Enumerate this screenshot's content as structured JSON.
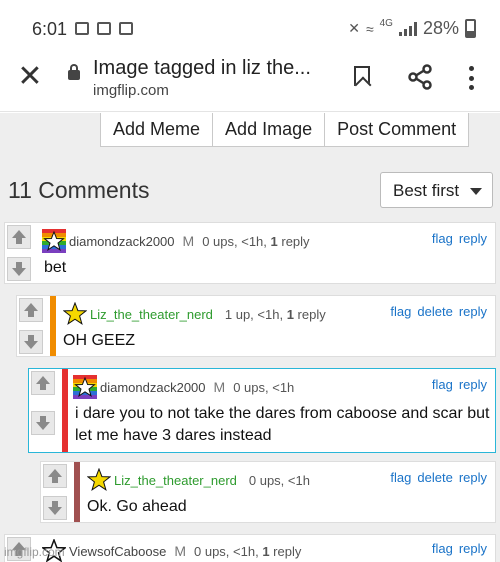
{
  "status": {
    "time": "6:01",
    "network": "4G",
    "battery": "28%"
  },
  "browser": {
    "title": "Image tagged in liz the...",
    "url": "imgflip.com"
  },
  "actions": {
    "add_meme": "Add Meme",
    "add_image": "Add Image",
    "post_comment": "Post Comment"
  },
  "comments_header": {
    "count_label": "11 Comments",
    "sort_selected": "Best first"
  },
  "comments": [
    {
      "user": "diamondzack2000",
      "badge": "M",
      "meta_pre": "0 ups, <1h, ",
      "meta_bold": "1",
      "meta_post": " reply",
      "links": [
        "flag",
        "reply"
      ],
      "text": "bet",
      "accent": ""
    },
    {
      "user": "Liz_the_theater_nerd",
      "badge": "",
      "meta_pre": "1 up, <1h, ",
      "meta_bold": "1",
      "meta_post": " reply",
      "links": [
        "flag",
        "delete",
        "reply"
      ],
      "text": "OH GEEZ",
      "accent": "#f08c00"
    },
    {
      "user": "diamondzack2000",
      "badge": "M",
      "meta_pre": "0 ups, <1h",
      "meta_bold": "",
      "meta_post": "",
      "links": [
        "flag",
        "reply"
      ],
      "text": "i dare you to not take the dares from caboose and scar but let me have 3 dares instead",
      "accent": "#e53030"
    },
    {
      "user": "Liz_the_theater_nerd",
      "badge": "",
      "meta_pre": "0 ups, <1h",
      "meta_bold": "",
      "meta_post": "",
      "links": [
        "flag",
        "delete",
        "reply"
      ],
      "text": "Ok. Go ahead",
      "accent": "#a05050"
    },
    {
      "user": "ViewsofCaboose",
      "badge": "M",
      "meta_pre": "0 ups, <1h, ",
      "meta_bold": "1",
      "meta_post": " reply",
      "links": [
        "flag",
        "reply"
      ],
      "text": "",
      "accent": ""
    }
  ],
  "watermark": "imgflip.com",
  "colors": {
    "link": "#1a73c8",
    "user_green": "#2e9b2e",
    "highlight_border": "#29b6d8"
  }
}
